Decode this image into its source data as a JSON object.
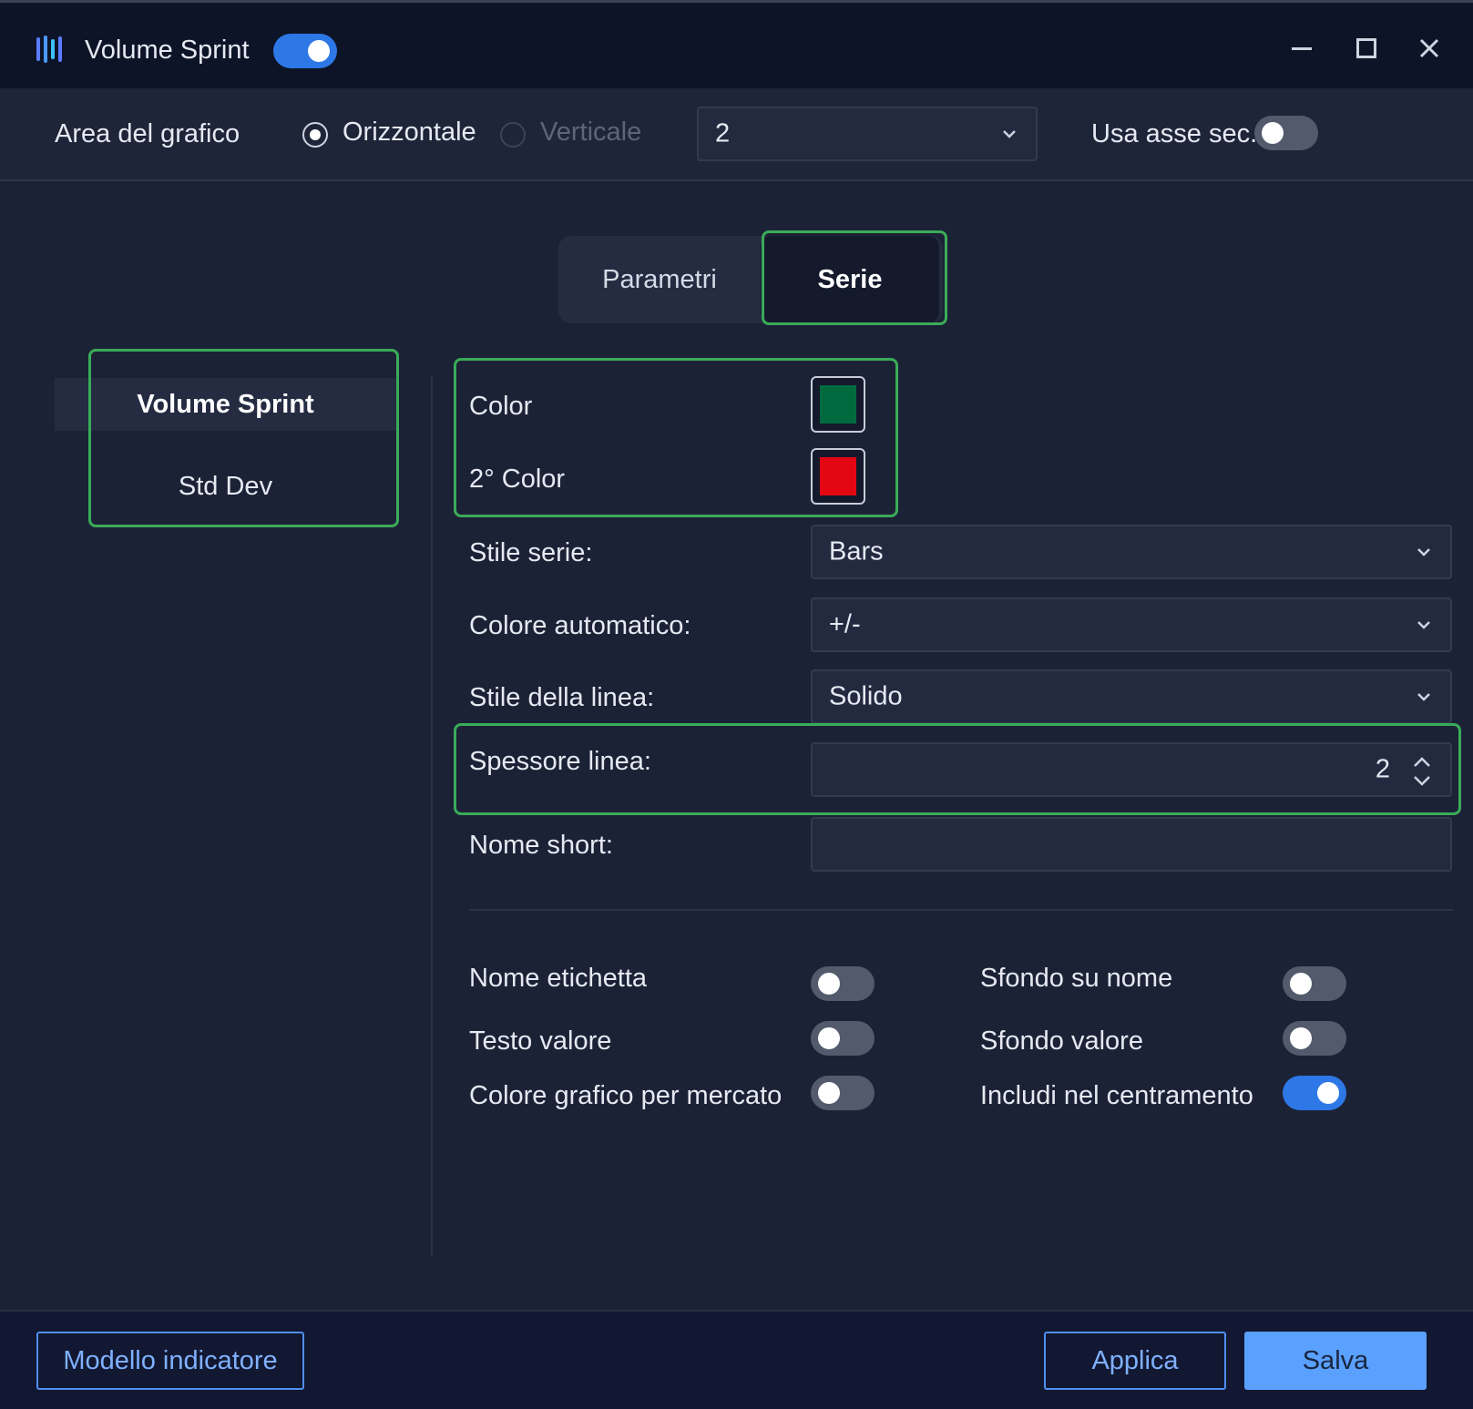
{
  "window": {
    "title": "Volume Sprint",
    "enabled": true,
    "controls": {
      "minimize": "minimize-icon",
      "maximize": "maximize-icon",
      "close": "close-icon"
    }
  },
  "chart_area": {
    "label": "Area del grafico",
    "orientation_options": [
      {
        "label": "Orizzontale",
        "checked": true
      },
      {
        "label": "Verticale",
        "checked": false,
        "disabled": true
      }
    ],
    "panel_select_value": "2",
    "secondary_axis_label": "Usa asse sec.",
    "secondary_axis_enabled": false
  },
  "tabs": [
    {
      "label": "Parametri",
      "active": false
    },
    {
      "label": "Serie",
      "active": true
    }
  ],
  "series_list": [
    {
      "label": "Volume Sprint",
      "active": true
    },
    {
      "label": "Std Dev",
      "active": false
    }
  ],
  "series_settings": {
    "color_label": "Color",
    "color_value": "#006a3e",
    "color2_label": "2° Color",
    "color2_value": "#e30613",
    "style_label": "Stile serie:",
    "style_value": "Bars",
    "auto_color_label": "Colore automatico:",
    "auto_color_value": "+/-",
    "line_style_label": "Stile della linea:",
    "line_style_value": "Solido",
    "line_width_label": "Spessore linea:",
    "line_width_value": "2",
    "short_name_label": "Nome short:",
    "short_name_value": ""
  },
  "toggles": {
    "name_label": {
      "label": "Nome etichetta",
      "on": false
    },
    "value_text": {
      "label": "Testo valore",
      "on": false
    },
    "market_color": {
      "label": "Colore grafico per mercato",
      "on": false
    },
    "name_background": {
      "label": "Sfondo su nome",
      "on": false
    },
    "value_background": {
      "label": "Sfondo valore",
      "on": false
    },
    "include_centering": {
      "label": "Includi nel centramento",
      "on": true
    }
  },
  "footer": {
    "template_button": "Modello indicatore",
    "apply_button": "Applica",
    "save_button": "Salva"
  },
  "colors": {
    "accent": "#2d78e6",
    "highlight": "#3aab58"
  }
}
